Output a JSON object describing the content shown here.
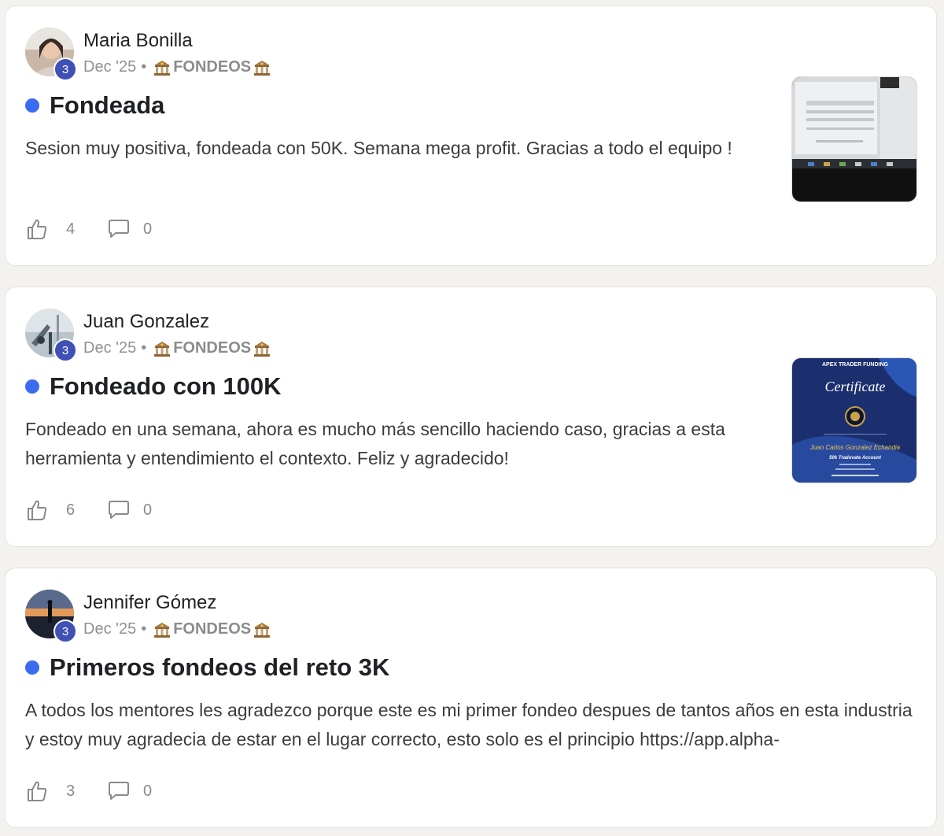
{
  "posts": [
    {
      "author": "Maria Bonilla",
      "level": "3",
      "date": "Dec '25",
      "separator": "•",
      "category": "FONDEOS",
      "title": "Fondeada",
      "body": "Sesion muy positiva, fondeada con 50K. Semana mega profit. Gracias a todo el equipo !",
      "likes": "4",
      "comments": "0",
      "has_thumbnail": true
    },
    {
      "author": "Juan Gonzalez",
      "level": "3",
      "date": "Dec '25",
      "separator": "•",
      "category": "FONDEOS",
      "title": "Fondeado con 100K",
      "body": "Fondeado en una semana, ahora es mucho más sencillo haciendo caso, gracias a esta herramienta y entendimiento el contexto. Feliz y agradecido!",
      "likes": "6",
      "comments": "0",
      "has_thumbnail": true,
      "thumbnail_text": {
        "brand": "APEX TRADER FUNDING",
        "heading": "Certificate",
        "name": "Juan Carlos Gonzalez Echandia",
        "account": "50k Tradovate Account"
      }
    },
    {
      "author": "Jennifer Gómez",
      "level": "3",
      "date": "Dec '25",
      "separator": "•",
      "category": "FONDEOS",
      "title": "Primeros fondeos del reto 3K",
      "body": "A todos los mentores les agradezco porque este es mi primer fondeo despues de tantos años en esta industria y estoy muy agradecia de estar en el lugar correcto, esto solo es el principio https://app.alpha-",
      "likes": "3",
      "comments": "0",
      "has_thumbnail": false
    }
  ],
  "icons": {
    "like": "thumbs-up-icon",
    "comment": "comment-bubble-icon",
    "category": "bank-icon",
    "unread": "unread-dot-icon"
  },
  "colors": {
    "unread_dot": "#3b6cf0",
    "level_badge": "#3f51b5",
    "background": "#f3f2ef"
  }
}
